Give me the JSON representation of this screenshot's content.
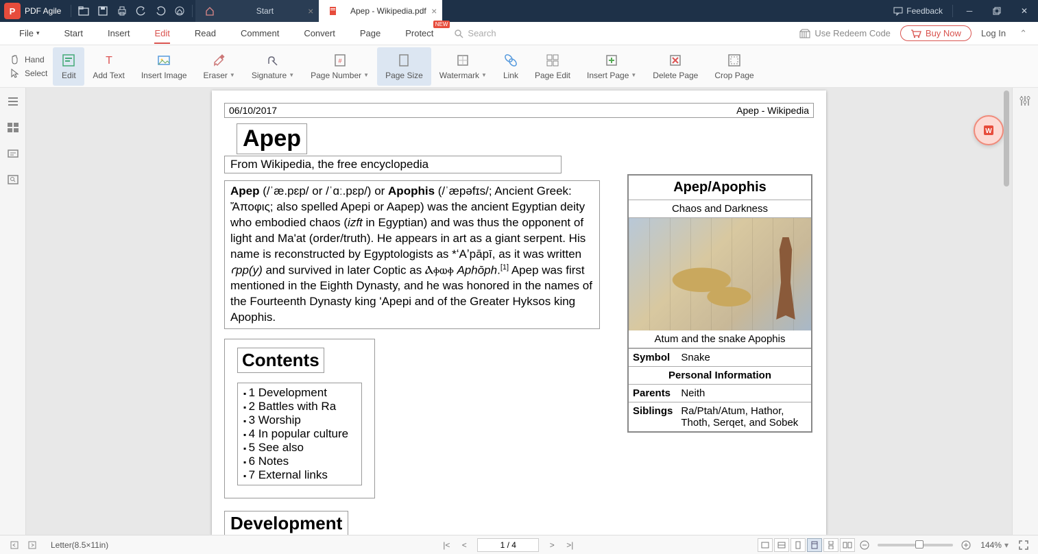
{
  "app": {
    "name": "PDF Agile"
  },
  "titlebar": {
    "tabs": [
      {
        "label": "Start",
        "active": false
      },
      {
        "label": "Apep - Wikipedia.pdf",
        "active": true
      }
    ],
    "feedback": "Feedback"
  },
  "menubar": {
    "items": [
      "File",
      "Start",
      "Insert",
      "Edit",
      "Read",
      "Comment",
      "Convert",
      "Page",
      "Protect"
    ],
    "active_index": 3,
    "new_badge_index": 8,
    "new_badge_text": "NEW",
    "search_placeholder": "Search",
    "redeem": "Use Redeem Code",
    "buy": "Buy Now",
    "login": "Log In"
  },
  "ribbon": {
    "left": {
      "hand": "Hand",
      "select": "Select"
    },
    "buttons": [
      {
        "label": "Edit",
        "sel": true
      },
      {
        "label": "Add Text"
      },
      {
        "label": "Insert Image"
      },
      {
        "label": "Eraser",
        "dd": true
      },
      {
        "label": "Signature",
        "dd": true
      },
      {
        "label": "Page Number",
        "dd": true
      },
      {
        "label": "Page Size",
        "sel": true
      },
      {
        "label": "Watermark",
        "dd": true
      },
      {
        "label": "Link"
      },
      {
        "label": "Page Edit"
      },
      {
        "label": "Insert Page",
        "dd": true
      },
      {
        "label": "Delete Page"
      },
      {
        "label": "Crop Page"
      }
    ]
  },
  "document": {
    "header_date": "06/10/2017",
    "header_source": "Apep - Wikipedia",
    "title": "Apep",
    "subtitle": "From Wikipedia, the free encyclopedia",
    "body_html": "<b>Apep</b> (/ˈæ.pɛp/ or /ˈɑː.pɛp/) or <b>Apophis</b> (/ˈæpəfɪs/; Ancient Greek: Ἄποφις; also spelled Apepi or Aapep) was the ancient Egyptian deity who embodied chaos (<span class='it'>izft</span> in Egyptian) and was thus the opponent of light and Ma'at (order/truth). He appears in art as a giant serpent. His name is reconstructed by Egyptologists as *ʻAʼpāpī, as it was written <span class='it'>ꜥpp(y)</span> and survived in later Coptic as Ⲁⲫⲱⲫ <span class='it'>Aphōph</span>.<sup>[1]</sup> Apep was first mentioned in the Eighth Dynasty, and he was honored in the names of the Fourteenth Dynasty king 'Apepi and of the Greater Hyksos king Apophis.",
    "contents_heading": "Contents",
    "contents": [
      "1  Development",
      "2  Battles with Ra",
      "3  Worship",
      "4  In popular culture",
      "5  See also",
      "6  Notes",
      "7  External links"
    ],
    "section_heading": "Development",
    "infobox": {
      "title": "Apep/Apophis",
      "subtitle": "Chaos and Darkness",
      "caption": "Atum and the snake Apophis",
      "rows": [
        {
          "k": "Symbol",
          "v": "Snake"
        }
      ],
      "section": "Personal Information",
      "rows2": [
        {
          "k": "Parents",
          "v": "Neith"
        },
        {
          "k": "Siblings",
          "v": "Ra/Ptah/Atum, Hathor, Thoth, Serqet, and Sobek"
        }
      ]
    }
  },
  "statusbar": {
    "page_size": "Letter(8.5×11in)",
    "page_counter": "1 / 4",
    "zoom": "144%"
  }
}
